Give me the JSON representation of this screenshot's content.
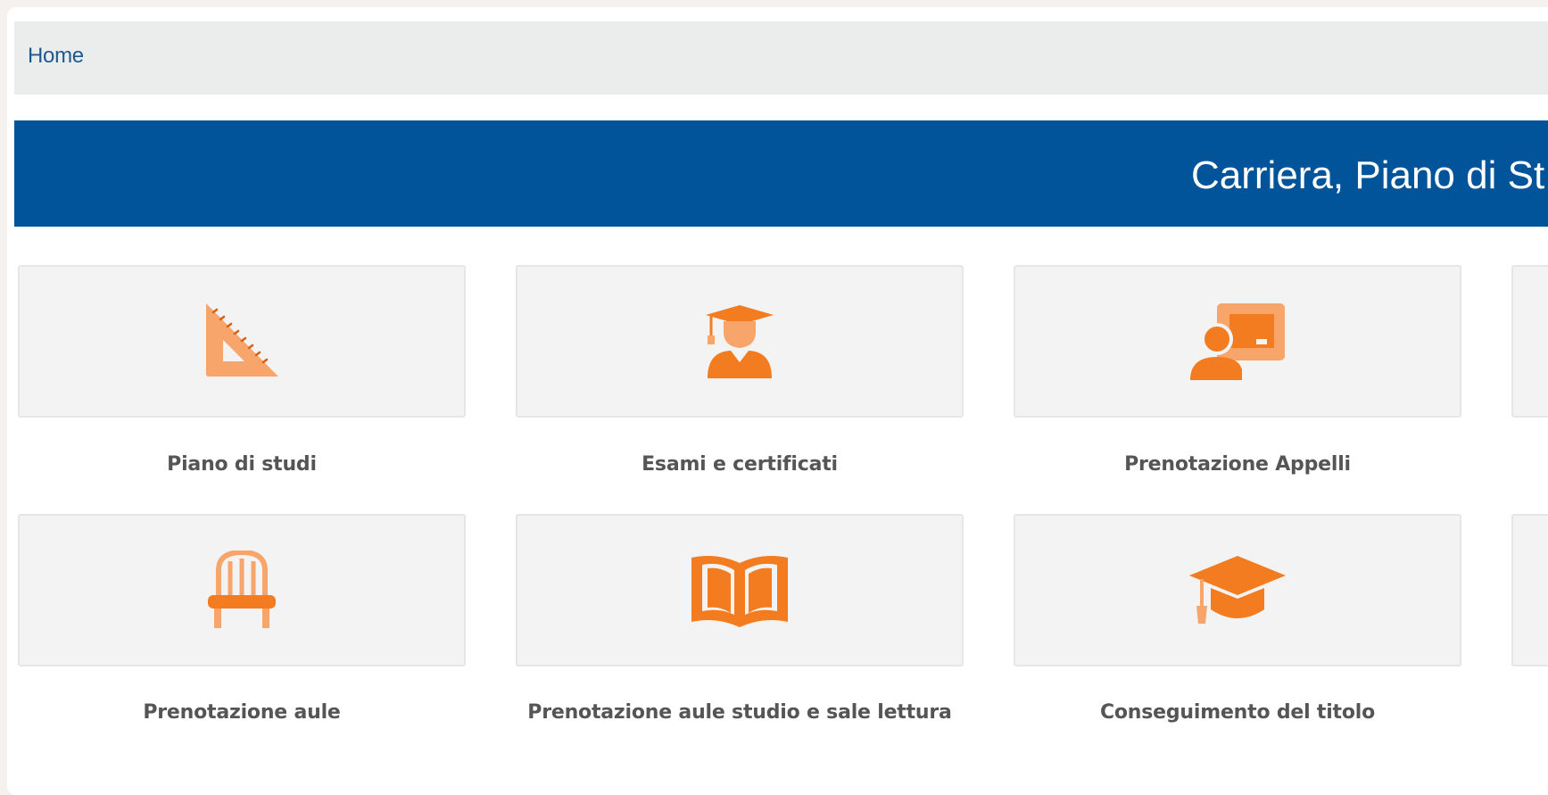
{
  "breadcrumb": {
    "home": "Home"
  },
  "header": {
    "title": "Carriera, Piano di St"
  },
  "tiles": [
    {
      "label": "Piano di studi",
      "icon": "set-square-icon"
    },
    {
      "label": "Esami e certificati",
      "icon": "graduate-student-icon"
    },
    {
      "label": "Prenotazione Appelli",
      "icon": "teacher-blackboard-icon"
    },
    {
      "label": "Prenotazione aule",
      "icon": "chair-icon"
    },
    {
      "label": "Prenotazione aule studio e sale lettura",
      "icon": "open-book-icon"
    },
    {
      "label": "Conseguimento del titolo",
      "icon": "graduation-cap-icon"
    }
  ],
  "colors": {
    "accent_orange": "#f47c20",
    "light_orange": "#f7a56b",
    "header_blue": "#02549a",
    "breadcrumb_blue": "#1d5b8f"
  }
}
